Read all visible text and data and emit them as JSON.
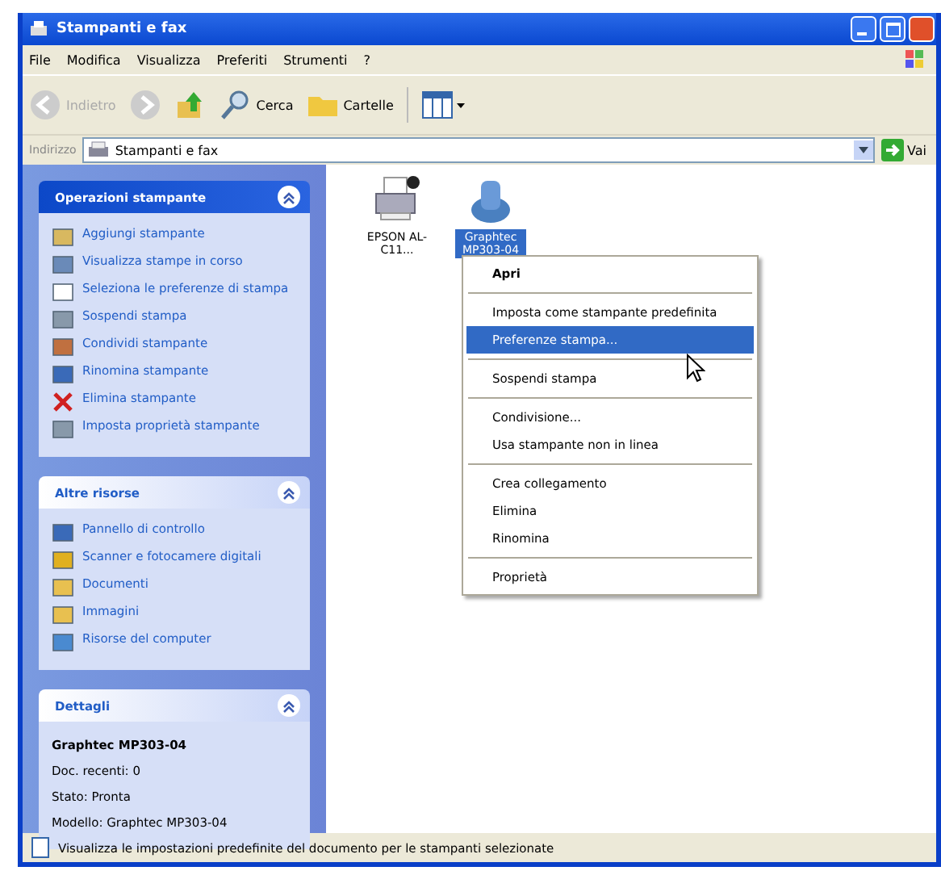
{
  "window": {
    "title": "Stampanti e fax"
  },
  "menu_bar": [
    "File",
    "Modifica",
    "Visualizza",
    "Preferiti",
    "Strumenti",
    "?"
  ],
  "toolbar": {
    "back": {
      "label": "Indietro",
      "disabled": true
    },
    "search": "Cerca",
    "folders": "Cartelle"
  },
  "address_bar": {
    "label": "Indirizzo",
    "value": "Stampanti e fax",
    "go": "Vai"
  },
  "sidebar": [
    {
      "title": "Operazioni stampante",
      "expanded": true,
      "items": [
        {
          "label": "Aggiungi stampante"
        },
        {
          "label": "Visualizza stampe in corso"
        },
        {
          "label": "Seleziona le preferenze di stampa"
        },
        {
          "label": "Sospendi stampa"
        },
        {
          "label": "Condividi stampante"
        },
        {
          "label": "Rinomina stampante"
        },
        {
          "label": "Elimina stampante"
        },
        {
          "label": "Imposta proprietà stampante"
        }
      ]
    },
    {
      "title": "Altre risorse",
      "expanded": true,
      "items": [
        {
          "label": "Pannello di controllo"
        },
        {
          "label": "Scanner e fotocamere digitali"
        },
        {
          "label": "Documenti"
        },
        {
          "label": "Immagini"
        },
        {
          "label": "Risorse del computer"
        }
      ]
    },
    {
      "title": "Dettagli",
      "expanded": true,
      "details": [
        {
          "text": "Graphtec MP303-04",
          "bold": true
        },
        {
          "text": "Doc. recenti: 0",
          "bold": false
        },
        {
          "text": "Stato: Pronta",
          "bold": false
        },
        {
          "text": "Modello: Graphtec MP303-04",
          "bold": false
        }
      ]
    }
  ],
  "printers": [
    {
      "name": "EPSON AL-C11...",
      "kind": "laser",
      "selected": false
    },
    {
      "name": "Graphtec MP303-04",
      "kind": "plotter",
      "selected": true
    }
  ],
  "context_menu": [
    {
      "label": "Apri",
      "kind": "item",
      "bold": true,
      "selected": false
    },
    {
      "kind": "separator"
    },
    {
      "label": "Imposta come stampante predefinita",
      "kind": "item",
      "bold": false,
      "selected": false
    },
    {
      "label": "Preferenze stampa...",
      "kind": "item",
      "bold": false,
      "selected": true
    },
    {
      "kind": "separator"
    },
    {
      "label": "Sospendi stampa",
      "kind": "item",
      "bold": false,
      "selected": false
    },
    {
      "kind": "separator"
    },
    {
      "label": "Condivisione...",
      "kind": "item",
      "bold": false,
      "selected": false
    },
    {
      "label": "Usa stampante non in linea",
      "kind": "item",
      "bold": false,
      "selected": false
    },
    {
      "kind": "separator"
    },
    {
      "label": "Crea collegamento",
      "kind": "item",
      "bold": false,
      "selected": false
    },
    {
      "label": "Elimina",
      "kind": "item",
      "bold": false,
      "selected": false
    },
    {
      "label": "Rinomina",
      "kind": "item",
      "bold": false,
      "selected": false
    },
    {
      "kind": "separator"
    },
    {
      "label": "Proprietà",
      "kind": "item",
      "bold": false,
      "selected": false
    }
  ],
  "status_bar": "Visualizza le impostazioni predefinite del documento per le stampanti selezionate"
}
